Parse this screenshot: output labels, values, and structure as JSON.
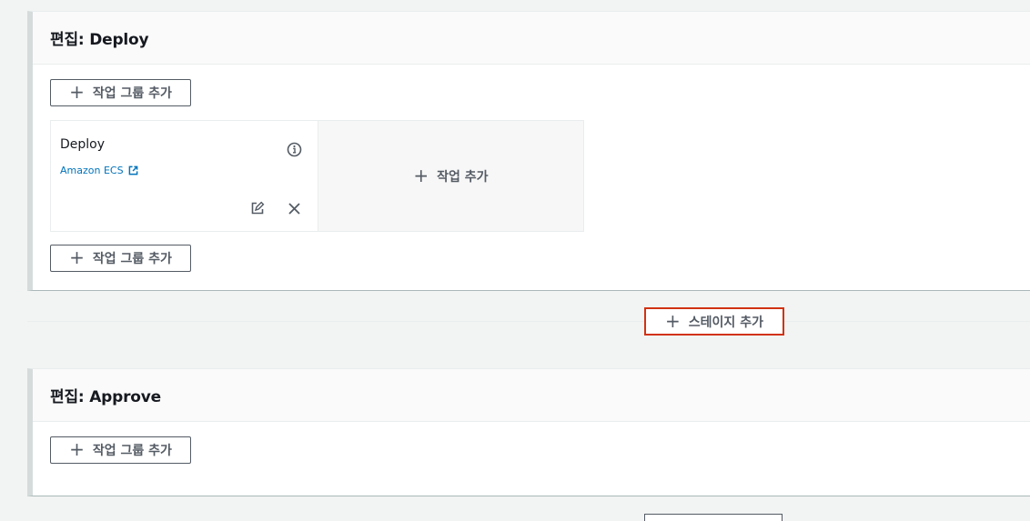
{
  "stages": [
    {
      "title": "편집: Deploy",
      "add_group_label": "작업 그룹 추가",
      "add_group_bottom_label": "작업 그룹 추가",
      "actions": [
        {
          "name": "Deploy",
          "provider": "Amazon ECS"
        }
      ],
      "add_action_label": "작업 추가"
    },
    {
      "title": "편집: Approve",
      "add_group_label": "작업 그룹 추가"
    }
  ],
  "add_stage_label": "스테이지 추가",
  "icons": {
    "plus": "plus-icon",
    "info": "info-icon",
    "edit": "edit-icon",
    "close": "close-icon",
    "external_link": "external-link-icon"
  },
  "colors": {
    "link": "#0073bb",
    "highlight_border": "#d13212",
    "stage_border": "#d5dbdb"
  }
}
